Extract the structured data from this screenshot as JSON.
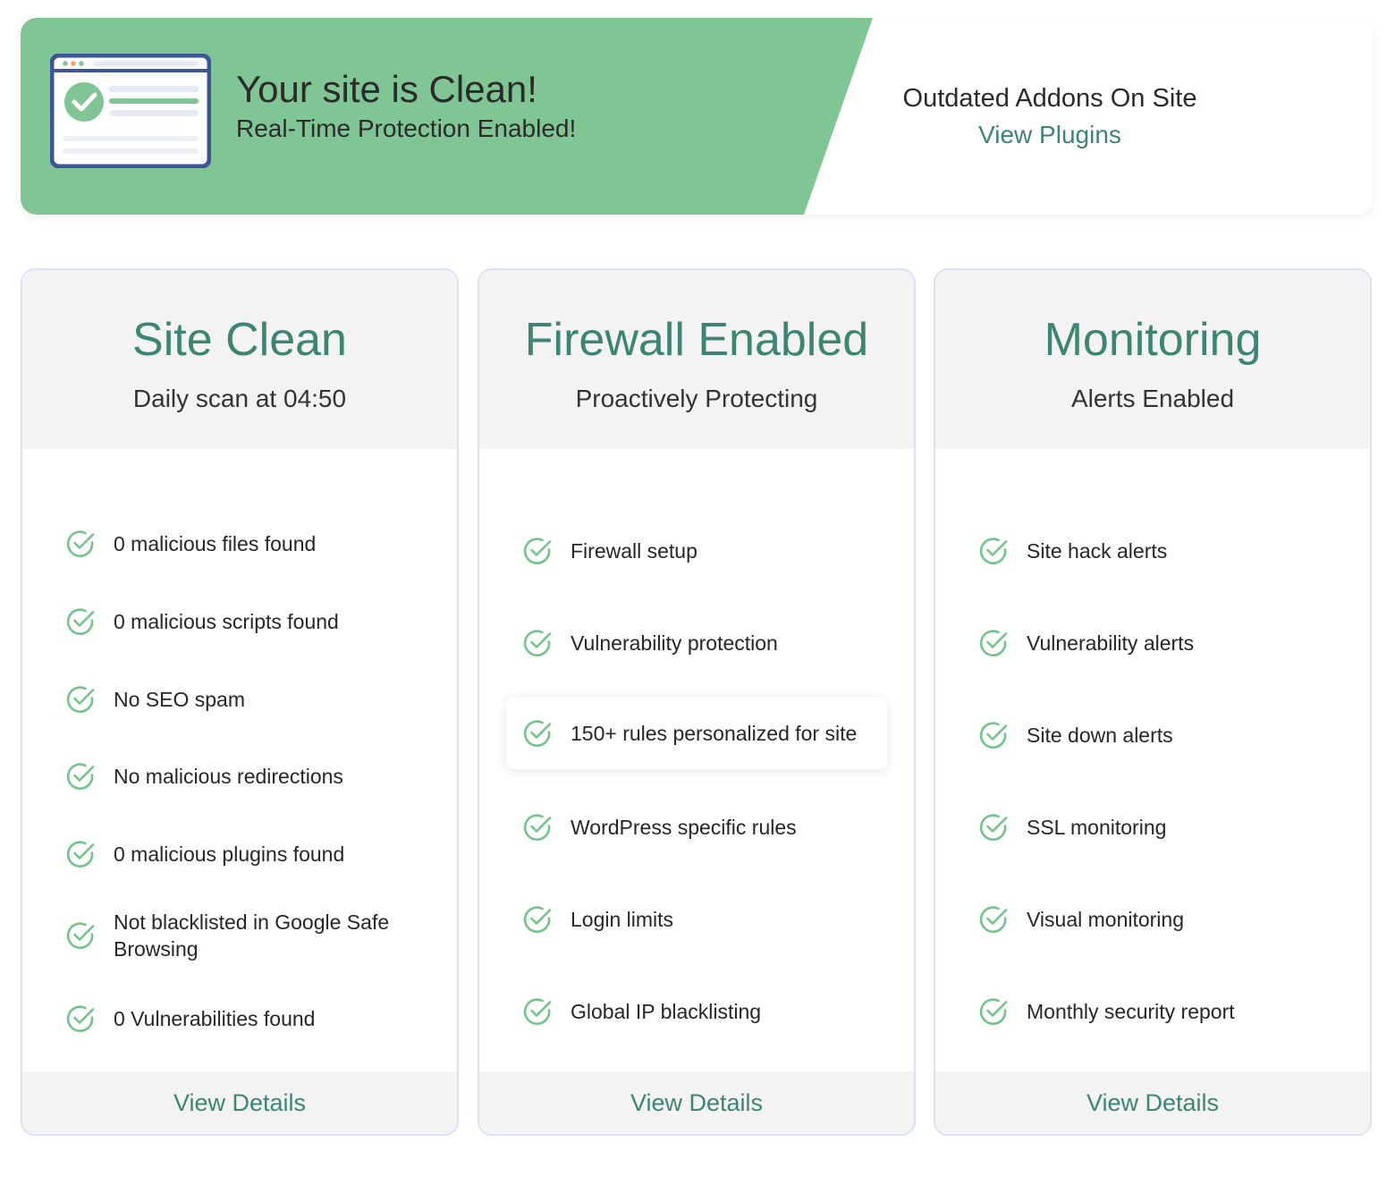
{
  "colors": {
    "banner_green": "#7fc694",
    "heading_teal": "#3d8573",
    "link_teal": "#3d8573",
    "check_green": "#72c48a",
    "browser_frame": "#3d5699"
  },
  "banner": {
    "title": "Your site is Clean!",
    "subtitle": "Real-Time Protection Enabled!",
    "addons_label": "Outdated Addons On Site",
    "addons_link": "View Plugins",
    "illustration_icon": "browser-check-icon"
  },
  "cards": [
    {
      "title": "Site Clean",
      "subtitle": "Daily scan at 04:50",
      "items": [
        "0 malicious files found",
        "0 malicious scripts found",
        "No SEO spam",
        "No malicious redirections",
        "0 malicious plugins found",
        "Not blacklisted in Google Safe Browsing",
        "0 Vulnerabilities found"
      ],
      "footer_link": "View Details"
    },
    {
      "title": "Firewall Enabled",
      "subtitle": "Proactively Protecting",
      "items": [
        "Firewall setup",
        "Vulnerability protection",
        "150+ rules personalized for site",
        "WordPress specific rules",
        "Login limits",
        "Global IP blacklisting"
      ],
      "footer_link": "View Details"
    },
    {
      "title": "Monitoring",
      "subtitle": "Alerts Enabled",
      "items": [
        "Site hack alerts",
        "Vulnerability alerts",
        "Site down alerts",
        "SSL monitoring",
        "Visual monitoring",
        "Monthly security report"
      ],
      "footer_link": "View Details"
    }
  ],
  "item_icon": "check-circle-icon"
}
